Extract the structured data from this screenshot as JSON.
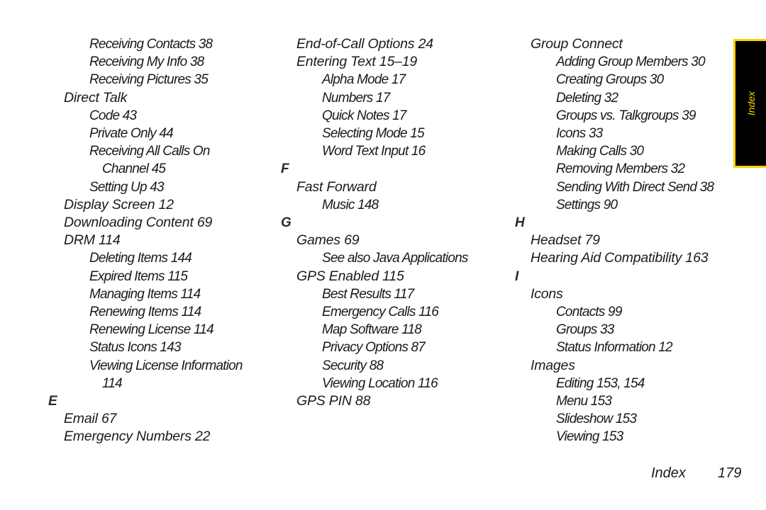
{
  "columns": [
    {
      "lines": [
        {
          "text": "Receiving Contacts 38",
          "level": 2
        },
        {
          "text": "Receiving My Info 38",
          "level": 2
        },
        {
          "text": "Receiving Pictures 35",
          "level": 2
        },
        {
          "text": "Direct Talk",
          "level": 1
        },
        {
          "text": "Code 43",
          "level": 2
        },
        {
          "text": "Private Only 44",
          "level": 2
        },
        {
          "text": "Receiving All Calls On",
          "level": 2
        },
        {
          "text": "Channel 45",
          "level": 3
        },
        {
          "text": "Setting Up 43",
          "level": 2
        },
        {
          "text": "Display Screen 12",
          "level": 1
        },
        {
          "text": "Downloading Content 69",
          "level": 1
        },
        {
          "text": "DRM 114",
          "level": 1
        },
        {
          "text": "Deleting Items 144",
          "level": 2
        },
        {
          "text": "Expired Items 115",
          "level": 2
        },
        {
          "text": "Managing Items 114",
          "level": 2
        },
        {
          "text": "Renewing Items 114",
          "level": 2
        },
        {
          "text": "Renewing License 114",
          "level": 2
        },
        {
          "text": "Status Icons 143",
          "level": 2
        },
        {
          "text": "Viewing License Information",
          "level": 2
        },
        {
          "text": "114",
          "level": 3
        },
        {
          "text": "E",
          "level": 0
        },
        {
          "text": "Email 67",
          "level": 1
        },
        {
          "text": "Emergency Numbers 22",
          "level": 1
        }
      ]
    },
    {
      "lines": [
        {
          "text": "End-of-Call Options 24",
          "level": 1
        },
        {
          "text": "Entering Text 15–19",
          "level": 1
        },
        {
          "text": "Alpha Mode 17",
          "level": 2
        },
        {
          "text": "Numbers 17",
          "level": 2
        },
        {
          "text": "Quick Notes 17",
          "level": 2
        },
        {
          "text": "Selecting Mode 15",
          "level": 2
        },
        {
          "text": "Word Text Input 16",
          "level": 2
        },
        {
          "text": "F",
          "level": 0
        },
        {
          "text": "Fast Forward",
          "level": 1
        },
        {
          "text": "Music 148",
          "level": 2
        },
        {
          "text": "G",
          "level": 0
        },
        {
          "text": "Games 69",
          "level": 1
        },
        {
          "text": "See also Java Applications",
          "level": 2
        },
        {
          "text": "GPS Enabled 115",
          "level": 1
        },
        {
          "text": "Best Results 117",
          "level": 2
        },
        {
          "text": "Emergency Calls 116",
          "level": 2
        },
        {
          "text": "Map Software 118",
          "level": 2
        },
        {
          "text": "Privacy Options 87",
          "level": 2
        },
        {
          "text": "Security 88",
          "level": 2
        },
        {
          "text": "Viewing Location 116",
          "level": 2
        },
        {
          "text": "GPS PIN 88",
          "level": 1
        }
      ]
    },
    {
      "lines": [
        {
          "text": "Group Connect",
          "level": 1
        },
        {
          "text": "Adding Group Members 30",
          "level": 2
        },
        {
          "text": "Creating Groups 30",
          "level": 2
        },
        {
          "text": "Deleting 32",
          "level": 2
        },
        {
          "text": "Groups vs. Talkgroups 39",
          "level": 2
        },
        {
          "text": "Icons 33",
          "level": 2
        },
        {
          "text": "Making Calls 30",
          "level": 2
        },
        {
          "text": "Removing Members 32",
          "level": 2
        },
        {
          "text": "Sending With Direct Send 38",
          "level": 2
        },
        {
          "text": "Settings 90",
          "level": 2
        },
        {
          "text": "H",
          "level": 0
        },
        {
          "text": "Headset 79",
          "level": 1
        },
        {
          "text": "Hearing Aid Compatibility 163",
          "level": 1
        },
        {
          "text": "I",
          "level": 0
        },
        {
          "text": "Icons",
          "level": 1
        },
        {
          "text": "Contacts 99",
          "level": 2
        },
        {
          "text": "Groups 33",
          "level": 2
        },
        {
          "text": "Status Information 12",
          "level": 2
        },
        {
          "text": "Images",
          "level": 1
        },
        {
          "text": "Editing 153, 154",
          "level": 2
        },
        {
          "text": "Menu 153",
          "level": 2
        },
        {
          "text": "Slideshow 153",
          "level": 2
        },
        {
          "text": "Viewing 153",
          "level": 2
        }
      ]
    }
  ],
  "tab": {
    "label": "Index",
    "colors": {
      "background": "#000000",
      "accent": "#f5d200"
    }
  },
  "footer": {
    "section": "Index",
    "page": "179"
  }
}
